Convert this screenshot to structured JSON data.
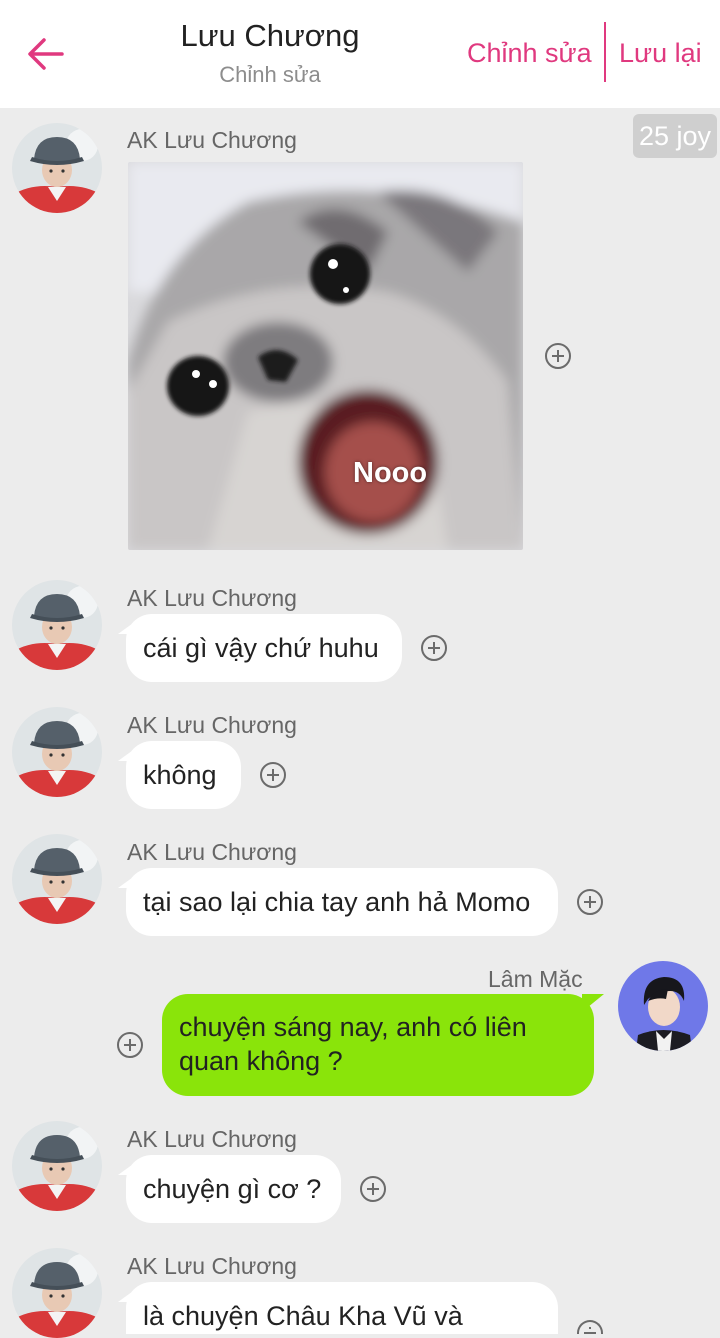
{
  "header": {
    "title": "Lưu Chương",
    "subtitle": "Chỉnh sửa",
    "edit_label": "Chỉnh sửa",
    "save_label": "Lưu lại",
    "accent_color": "#e0397f"
  },
  "badge": {
    "label": "25 joy"
  },
  "photo": {
    "caption": "Nooo"
  },
  "messages": [
    {
      "sender": "AK Lưu Chương",
      "type": "image"
    },
    {
      "sender": "AK Lưu Chương",
      "text": "cái gì vậy chứ huhu"
    },
    {
      "sender": "AK Lưu Chương",
      "text": "không"
    },
    {
      "sender": "AK Lưu Chương",
      "text": "tại sao lại chia tay anh hả Momo"
    },
    {
      "sender": "Lâm Mặc",
      "text": "chuyện sáng nay, anh có liên quan không ?",
      "outgoing": true
    },
    {
      "sender": "AK Lưu Chương",
      "text": "chuyện gì cơ ?"
    },
    {
      "sender": "AK Lưu Chương",
      "text": "là chuyện Châu Kha Vũ và"
    }
  ],
  "colors": {
    "outgoing_bubble": "#8ae40a",
    "incoming_bubble": "#ffffff",
    "background": "#ececec"
  }
}
